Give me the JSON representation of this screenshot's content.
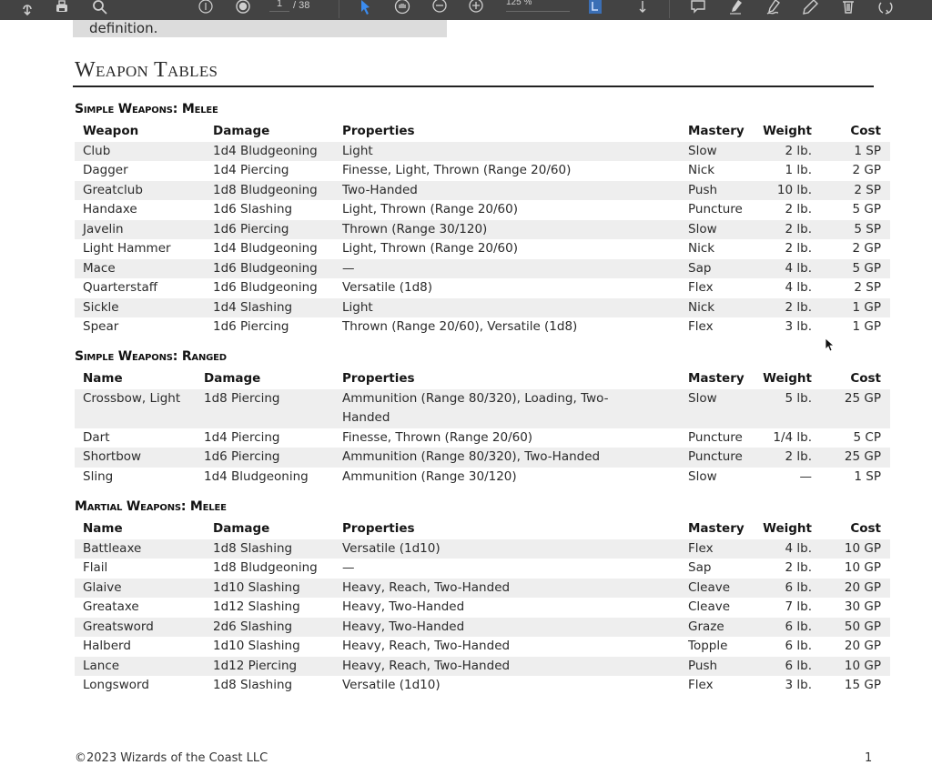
{
  "toolbar": {
    "page_current": "1",
    "page_total": "/ 38",
    "zoom_level": "125 %",
    "icons": [
      "upload-icon",
      "print-icon",
      "search-icon",
      "page-up-icon",
      "page-down-icon",
      "select-pointer-icon",
      "hand-tool-icon",
      "zoom-out-icon",
      "zoom-in-icon",
      "fit-page-icon",
      "scroll-icon",
      "comment-icon",
      "highlight-icon",
      "sign-icon",
      "edit-icon",
      "delete-icon",
      "rotate-icon"
    ]
  },
  "note_text": "definition.",
  "section_title": "Weapon Tables",
  "tables": [
    {
      "caption": "Simple Weapons: Melee",
      "headers": [
        "Weapon",
        "Damage",
        "Properties",
        "Mastery",
        "Weight",
        "Cost"
      ],
      "rows": [
        [
          "Club",
          "1d4 Bludgeoning",
          "Light",
          "Slow",
          "2 lb.",
          "1 SP"
        ],
        [
          "Dagger",
          "1d4 Piercing",
          "Finesse, Light, Thrown (Range 20/60)",
          "Nick",
          "1 lb.",
          "2 GP"
        ],
        [
          "Greatclub",
          "1d8 Bludgeoning",
          "Two-Handed",
          "Push",
          "10 lb.",
          "2 SP"
        ],
        [
          "Handaxe",
          "1d6 Slashing",
          "Light, Thrown (Range 20/60)",
          "Puncture",
          "2 lb.",
          "5 GP"
        ],
        [
          "Javelin",
          "1d6 Piercing",
          "Thrown (Range 30/120)",
          "Slow",
          "2 lb.",
          "5 SP"
        ],
        [
          "Light Hammer",
          "1d4 Bludgeoning",
          "Light, Thrown (Range 20/60)",
          "Nick",
          "2 lb.",
          "2 GP"
        ],
        [
          "Mace",
          "1d6 Bludgeoning",
          "—",
          "Sap",
          "4 lb.",
          "5 GP"
        ],
        [
          "Quarterstaff",
          "1d6 Bludgeoning",
          "Versatile (1d8)",
          "Flex",
          "4 lb.",
          "2 SP"
        ],
        [
          "Sickle",
          "1d4 Slashing",
          "Light",
          "Nick",
          "2 lb.",
          "1 GP"
        ],
        [
          "Spear",
          "1d6 Piercing",
          "Thrown (Range 20/60), Versatile (1d8)",
          "Flex",
          "3 lb.",
          "1 GP"
        ]
      ]
    },
    {
      "caption": "Simple Weapons: Ranged",
      "headers": [
        "Name",
        "Damage",
        "Properties",
        "Mastery",
        "Weight",
        "Cost"
      ],
      "rows": [
        [
          "Crossbow, Light",
          "1d8 Piercing",
          "Ammunition (Range 80/320), Loading, Two-Handed",
          "Slow",
          "5 lb.",
          "25 GP"
        ],
        [
          "Dart",
          "1d4 Piercing",
          "Finesse, Thrown (Range 20/60)",
          "Puncture",
          "1/4 lb.",
          "5 CP"
        ],
        [
          "Shortbow",
          "1d6 Piercing",
          "Ammunition (Range 80/320), Two-Handed",
          "Puncture",
          "2 lb.",
          "25 GP"
        ],
        [
          "Sling",
          "1d4 Bludgeoning",
          "Ammunition (Range 30/120)",
          "Slow",
          "—",
          "1 SP"
        ]
      ]
    },
    {
      "caption": "Martial Weapons: Melee",
      "headers": [
        "Name",
        "Damage",
        "Properties",
        "Mastery",
        "Weight",
        "Cost"
      ],
      "rows": [
        [
          "Battleaxe",
          "1d8 Slashing",
          "Versatile (1d10)",
          "Flex",
          "4 lb.",
          "10 GP"
        ],
        [
          "Flail",
          "1d8 Bludgeoning",
          "—",
          "Sap",
          "2 lb.",
          "10 GP"
        ],
        [
          "Glaive",
          "1d10 Slashing",
          "Heavy, Reach, Two-Handed",
          "Cleave",
          "6 lb.",
          "20 GP"
        ],
        [
          "Greataxe",
          "1d12 Slashing",
          "Heavy, Two-Handed",
          "Cleave",
          "7 lb.",
          "30 GP"
        ],
        [
          "Greatsword",
          "2d6 Slashing",
          "Heavy, Two-Handed",
          "Graze",
          "6 lb.",
          "50 GP"
        ],
        [
          "Halberd",
          "1d10 Slashing",
          "Heavy, Reach, Two-Handed",
          "Topple",
          "6 lb.",
          "20 GP"
        ],
        [
          "Lance",
          "1d12 Piercing",
          "Heavy, Reach, Two-Handed",
          "Push",
          "6 lb.",
          "10 GP"
        ],
        [
          "Longsword",
          "1d8 Slashing",
          "Versatile (1d10)",
          "Flex",
          "3 lb.",
          "15 GP"
        ]
      ]
    }
  ],
  "footer": {
    "copyright": "©2023 Wizards of the Coast LLC",
    "page_number": "1"
  }
}
